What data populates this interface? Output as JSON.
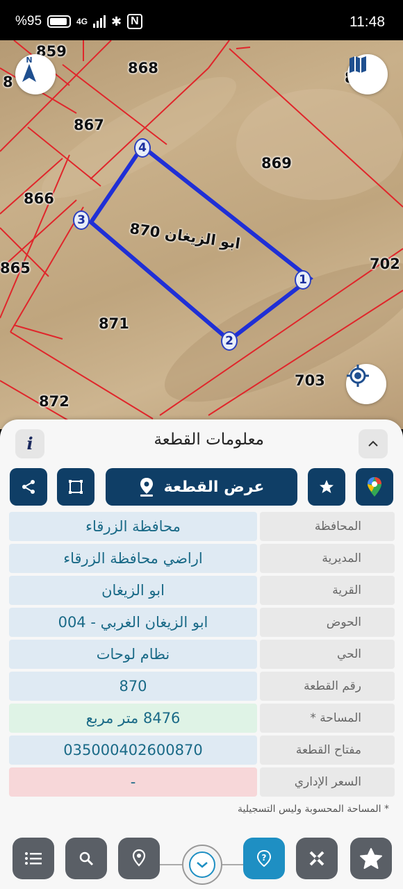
{
  "status_bar": {
    "battery": "%95",
    "network": "4G",
    "time": "11:48"
  },
  "map": {
    "selected_plot": "870",
    "selected_village": "ابو الزيغان",
    "selected_label": "ابو الزيغان 870",
    "plot_labels": [
      "859",
      "868",
      "867",
      "869",
      "866",
      "865",
      "871",
      "702",
      "703",
      "872"
    ],
    "partial_labels": [
      "8",
      "8"
    ],
    "vertices": [
      "1",
      "2",
      "3",
      "4"
    ],
    "compass_letter": "N",
    "colors": {
      "parcel_lines": "#e0262b",
      "selected_outline": "#1f2fd6"
    }
  },
  "sheet": {
    "title": "معلومات القطعة",
    "info_icon": "i",
    "show_plot_label": "عرض القطعة",
    "fields": [
      {
        "label": "المحافظة",
        "value": "محافظة الزرقاء"
      },
      {
        "label": "المديرية",
        "value": "اراضي محافظة الزرقاء"
      },
      {
        "label": "القرية",
        "value": "ابو الزيغان"
      },
      {
        "label": "الحوض",
        "value": "ابو الزيغان الغربي - 004"
      },
      {
        "label": "الحي",
        "value": "نظام لوحات"
      },
      {
        "label": "رقم القطعة",
        "value": "870"
      },
      {
        "label": "المساحة *",
        "value": "8476  متر مربع"
      },
      {
        "label": "مفتاح القطعة",
        "value": "035000402600870"
      },
      {
        "label": "السعر الإداري",
        "value": "-"
      }
    ],
    "footnote": "* المساحة المحسوبة وليس التسجيلية"
  },
  "icons": [
    "share-icon",
    "polygon-icon",
    "location-pin-icon",
    "star-icon",
    "google-maps-icon",
    "list-icon",
    "search-icon",
    "pin-icon",
    "chevron-down-icon",
    "help-icon",
    "tools-icon",
    "star-icon"
  ],
  "accent": "#0f3e66"
}
